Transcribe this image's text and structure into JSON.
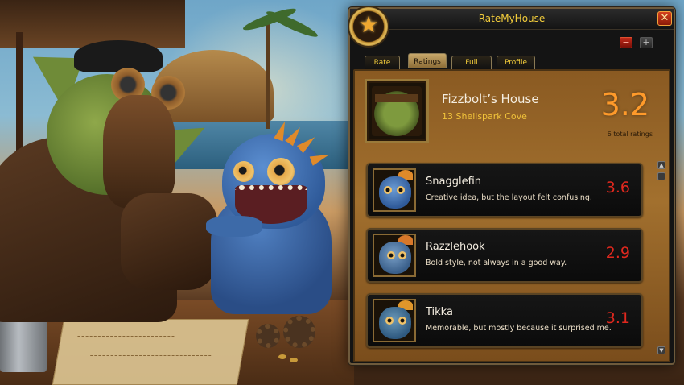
{
  "addon": {
    "title": "RateMyHouse",
    "close_symbol": "✕",
    "minus_symbol": "−",
    "plus_symbol": "+"
  },
  "tabs": [
    {
      "label": "Rate",
      "active": false
    },
    {
      "label": "Ratings",
      "active": true
    },
    {
      "label": "Full Review",
      "active": false
    },
    {
      "label": "Profile",
      "active": false
    }
  ],
  "house": {
    "name": "Fizzbolt’s House",
    "address": "13 Shellspark Cove",
    "overall_score": "3.2",
    "total_ratings": "6 total ratings"
  },
  "ratings": [
    {
      "name": "Snagglefin",
      "comment": "Creative idea, but the layout felt confusing.",
      "score": "3.6"
    },
    {
      "name": "Razzlehook",
      "comment": "Bold style, not always in a good way.",
      "score": "2.9"
    },
    {
      "name": "Tikka",
      "comment": "Memorable, but mostly because it surprised me.",
      "score": "3.1"
    }
  ],
  "colors": {
    "title_gold": "#f2cc3b",
    "overall_score_orange": "#ff9a2a",
    "rating_score_red": "#e0281e",
    "panel_brown": "#a2702e"
  },
  "icons": [
    "star-icon",
    "close-icon",
    "minus-icon",
    "plus-icon",
    "scroll-up-icon",
    "scroll-down-icon"
  ]
}
